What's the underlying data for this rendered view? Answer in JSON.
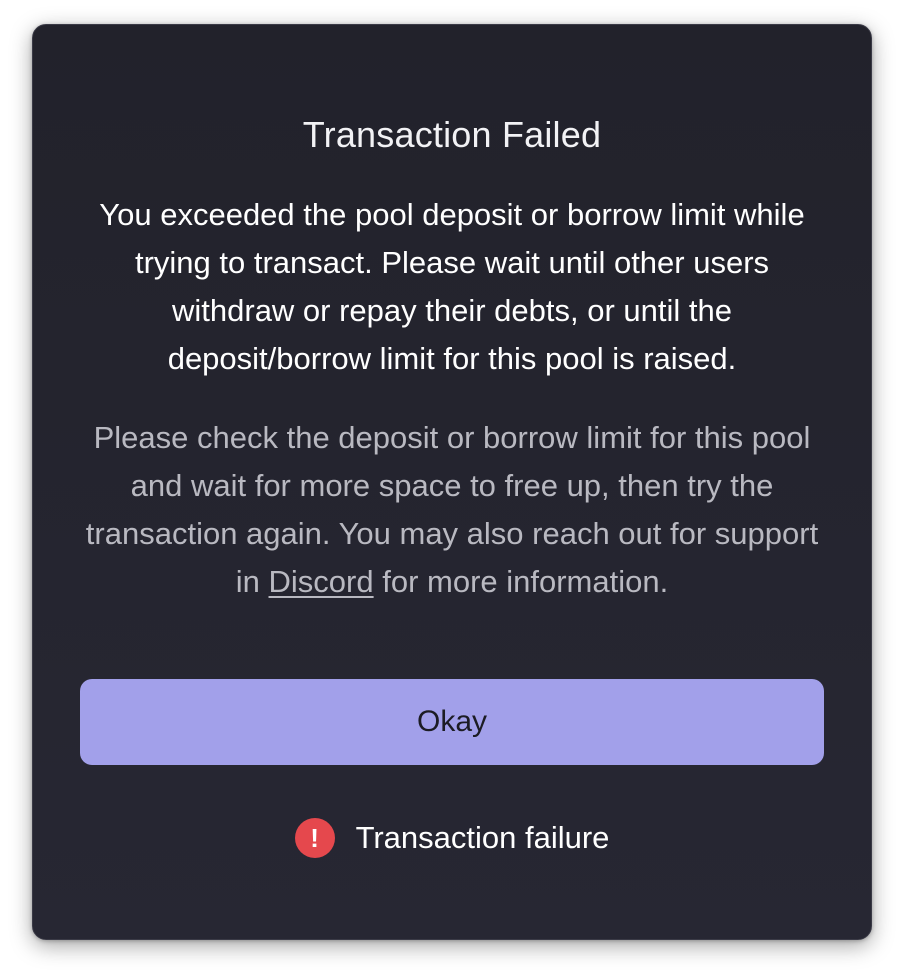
{
  "dialog": {
    "title": "Transaction Failed",
    "message": "You exceeded the pool deposit or borrow limit while trying to transact. Please wait until other users withdraw or repay their debts, or until the deposit/borrow limit for this pool is raised.",
    "help_before": "Please check the deposit or borrow limit for this pool and wait for more space to free up, then try the transaction again. You may also reach out for support in ",
    "help_link": "Discord",
    "help_after": " for more information.",
    "button_label": "Okay"
  },
  "status": {
    "icon": "alert-circle-icon",
    "icon_glyph": "!",
    "text": "Transaction failure",
    "color": "#e5484d"
  },
  "colors": {
    "background": "#22222b",
    "accent": "#a2a0ea"
  }
}
